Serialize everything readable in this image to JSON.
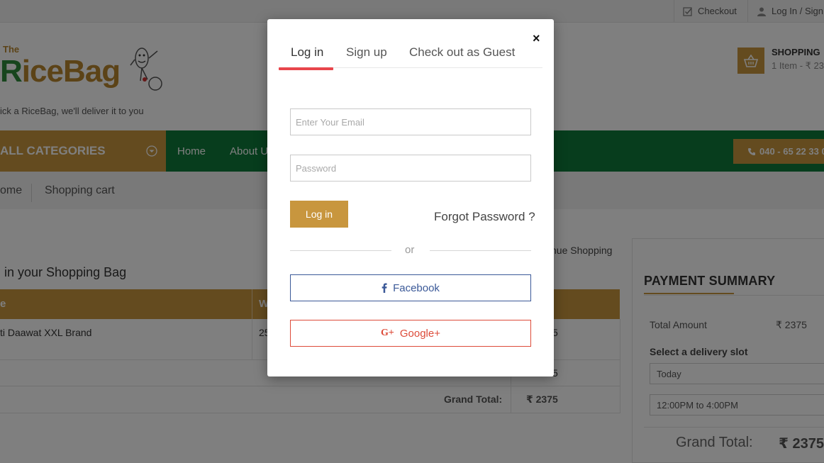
{
  "topbar": {
    "checkout": "Checkout",
    "login": "Log In / Sign"
  },
  "logo": {
    "the": "The",
    "r": "R",
    "rest": "iceBag",
    "tagline": "ick a RiceBag, we'll deliver it to you"
  },
  "cart": {
    "title": "SHOPPING",
    "summary": "1 Item - ₹ 23"
  },
  "nav": {
    "categories": "ALL CATEGORIES",
    "home": "Home",
    "about": "About U",
    "phone": "040 - 65 22 33 0"
  },
  "breadcrumb": {
    "home": "ome",
    "current": "Shopping cart"
  },
  "bag": {
    "continue": "tinue Shopping",
    "title": "in your Shopping Bag",
    "headers": [
      "e",
      "W"
    ],
    "item_name": "ti Daawat XXL Brand",
    "item_weight": "25",
    "item_price_tail": "5",
    "subtotal_tail": "5",
    "grand_total_label": "Grand Total:",
    "grand_total_value": "₹  2375"
  },
  "summary": {
    "title": "PAYMENT SUMMARY",
    "total_label": "Total Amount",
    "total_value": "₹  2375",
    "slot_label": "Select a delivery slot",
    "day": "Today",
    "time": "12:00PM to 4:00PM",
    "grand_label": "Grand Total:",
    "grand_value": "₹ 2375"
  },
  "modal": {
    "close": "×",
    "tabs": [
      "Log in",
      "Sign up",
      "Check out as Guest"
    ],
    "email_placeholder": "Enter Your Email",
    "password_placeholder": "Password",
    "login_button": "Log in",
    "forgot": "Forgot Password ?",
    "or": "or",
    "facebook": "Facebook",
    "google": "Google+"
  },
  "colors": {
    "brand_gold": "#c8963e",
    "nav_green": "#0f7b3a",
    "tab_active": "#e8454c",
    "facebook": "#3b5998",
    "google": "#dd4b39"
  }
}
